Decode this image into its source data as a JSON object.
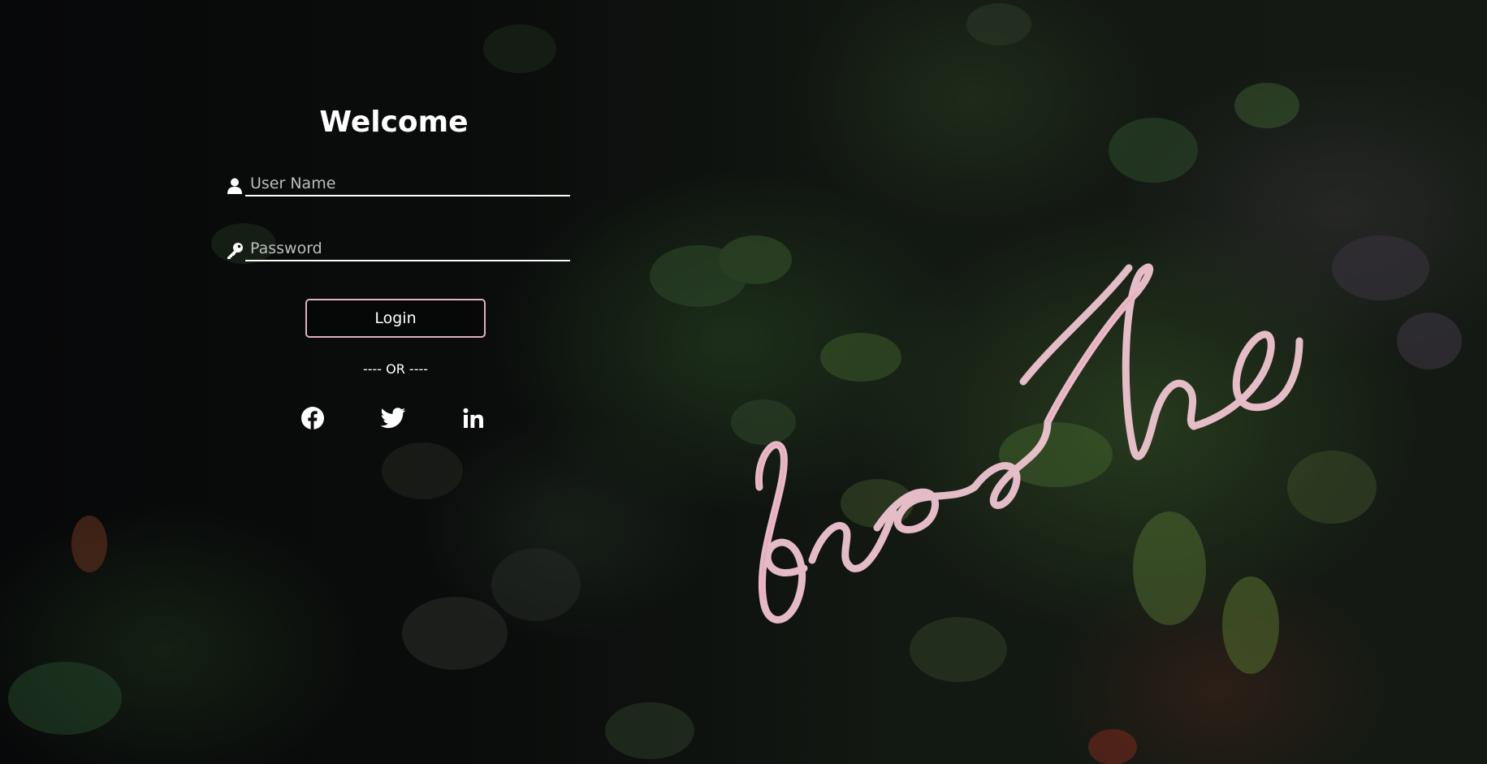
{
  "login": {
    "title": "Welcome",
    "username_placeholder": "User Name",
    "password_placeholder": "Password",
    "button_label": "Login",
    "divider_text": "---- OR ----"
  },
  "social": [
    {
      "name": "facebook",
      "icon": "facebook-icon"
    },
    {
      "name": "twitter",
      "icon": "twitter-icon"
    },
    {
      "name": "linkedin",
      "icon": "linkedin-icon"
    }
  ],
  "background": {
    "neon_sign": "breathe",
    "neon_color": "#f6c9d6",
    "button_border_color": "#e0b0bd"
  }
}
